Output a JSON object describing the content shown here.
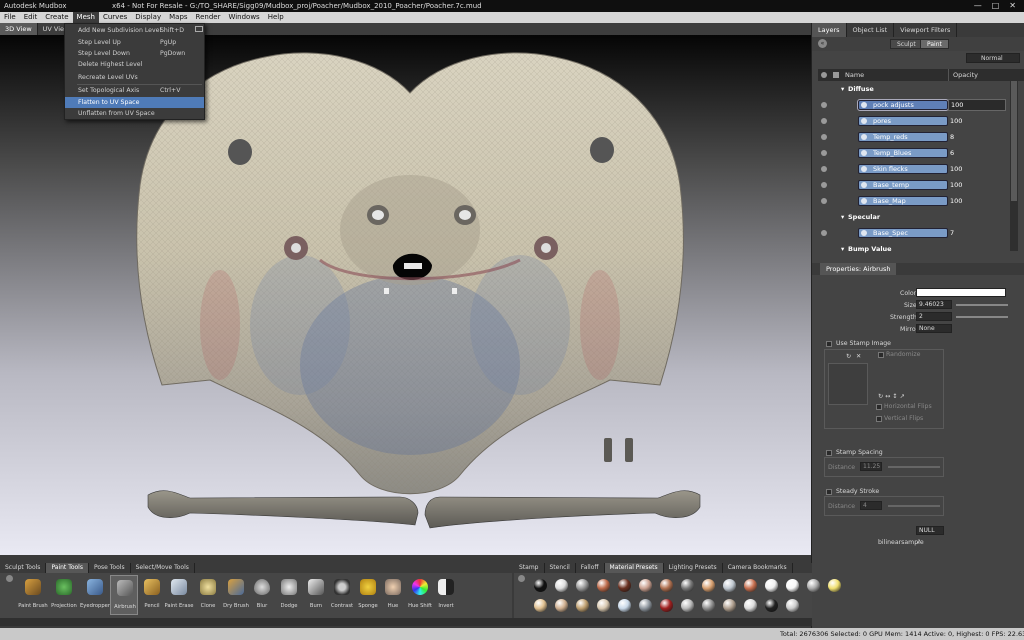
{
  "title": {
    "app": "Autodesk Mudbox",
    "info": "x64 - Not For Resale - G:/TO_SHARE/Sigg09/Mudbox_proj/Poacher/Mudbox_2010_Poacher/Poacher.7c.mud"
  },
  "menubar": [
    "File",
    "Edit",
    "Create",
    "Mesh",
    "Curves",
    "Display",
    "Maps",
    "Render",
    "Windows",
    "Help"
  ],
  "view_tabs": [
    "3D View",
    "UV View"
  ],
  "mesh_menu": [
    {
      "label": "Add New Subdivision Level",
      "shortcut": "Shift+D"
    },
    {
      "label": "Step Level Up",
      "shortcut": "PgUp"
    },
    {
      "label": "Step Level Down",
      "shortcut": "PgDown"
    },
    {
      "label": "Delete Highest Level",
      "shortcut": ""
    },
    {
      "label": "Recreate Level UVs",
      "shortcut": ""
    },
    {
      "label": "Set Topological Axis",
      "shortcut": "Ctrl+V"
    },
    {
      "label": "Flatten to UV Space",
      "shortcut": ""
    },
    {
      "label": "Unflatten from UV Space",
      "shortcut": ""
    }
  ],
  "right_tabs": [
    "Layers",
    "Object List",
    "Viewport Filters"
  ],
  "mode_buttons": [
    "Sculpt",
    "Paint"
  ],
  "blend_mode": "Normal",
  "layer_header": {
    "name": "Name",
    "opacity": "Opacity"
  },
  "layers": [
    {
      "name": "Diffuse",
      "opacity": "",
      "group": true
    },
    {
      "name": "pock adjusts",
      "opacity": "100",
      "selected": true
    },
    {
      "name": "pores",
      "opacity": "100"
    },
    {
      "name": "Temp_reds",
      "opacity": "8"
    },
    {
      "name": "Temp_Blues",
      "opacity": "6"
    },
    {
      "name": "Skin flecks",
      "opacity": "100"
    },
    {
      "name": "Base_temp",
      "opacity": "100"
    },
    {
      "name": "Base_Map",
      "opacity": "100"
    },
    {
      "name": "Specular",
      "opacity": "",
      "group": true
    },
    {
      "name": "Base_Spec",
      "opacity": "7"
    },
    {
      "name": "Bump Value",
      "opacity": "",
      "group": true
    }
  ],
  "properties": {
    "tab": "Properties: Airbrush",
    "color_label": "Color",
    "size_label": "Size",
    "size_value": "9.46023",
    "strength_label": "Strength",
    "strength_value": "2",
    "mirror_label": "Mirror",
    "mirror_value": "None",
    "stamp_image": "Use Stamp Image",
    "randomize": "Randomize",
    "horizontal_flips": "Horizontal Flips",
    "vertical_flips": "Vertical Flips",
    "stamp_spacing": "Stamp Spacing",
    "distance_label": "Distance",
    "stamp_distance": "11.25",
    "steady_stroke": "Steady Stroke",
    "steady_distance": "4",
    "null_value": "NULL",
    "bilinear": "bilinearsample"
  },
  "tool_tabs": [
    "Sculpt Tools",
    "Paint Tools",
    "Pose Tools",
    "Select/Move Tools"
  ],
  "tools": [
    "Paint Brush",
    "Projection",
    "Eyedropper",
    "Airbrush",
    "Pencil",
    "Paint Erase",
    "Clone",
    "Dry Brush",
    "Blur",
    "Dodge",
    "Burn",
    "Contrast",
    "Sponge",
    "Hue",
    "Hue Shift",
    "Invert"
  ],
  "material_tabs": [
    "Stamp",
    "Stencil",
    "Falloff",
    "Material Presets",
    "Lighting Presets",
    "Camera Bookmarks"
  ],
  "status": "Total: 2676306  Selected: 0 GPU Mem: 1414  Active: 0, Highest: 0  FPS: 22.6395",
  "colors": {
    "accent": "#4f7bb8",
    "layer_blue": "#7a9bc6",
    "skin": "#cfc8b4"
  }
}
